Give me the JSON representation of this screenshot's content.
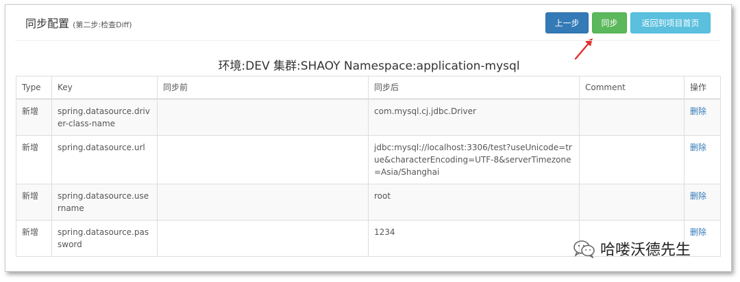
{
  "header": {
    "title": "同步配置",
    "subtitle": "(第二步:检查Diff)"
  },
  "buttons": {
    "prev_label": "上一步",
    "sync_label": "同步",
    "home_label": "返回到项目首页"
  },
  "env_title": "环境:DEV 集群:SHAOY Namespace:application-mysql",
  "table": {
    "columns": [
      "Type",
      "Key",
      "同步前",
      "同步后",
      "Comment",
      "操作"
    ],
    "rows": [
      {
        "type": "新增",
        "key": "spring.datasource.driver-class-name",
        "before": "",
        "after": "com.mysql.cj.jdbc.Driver",
        "comment": "",
        "action": "删除"
      },
      {
        "type": "新增",
        "key": "spring.datasource.url",
        "before": "",
        "after": "jdbc:mysql://localhost:3306/test?useUnicode=true&characterEncoding=UTF-8&serverTimezone=Asia/Shanghai",
        "comment": "",
        "action": "删除"
      },
      {
        "type": "新增",
        "key": "spring.datasource.username",
        "before": "",
        "after": "root",
        "comment": "",
        "action": "删除"
      },
      {
        "type": "新增",
        "key": "spring.datasource.password",
        "before": "",
        "after": "1234",
        "comment": "",
        "action": "删除"
      }
    ]
  },
  "watermark": {
    "text": "哈喽沃德先生",
    "icon": "wechat-icon"
  },
  "colors": {
    "primary": "#337ab7",
    "success": "#5cb85c",
    "info": "#5bc0de",
    "arrow": "#e03030"
  }
}
